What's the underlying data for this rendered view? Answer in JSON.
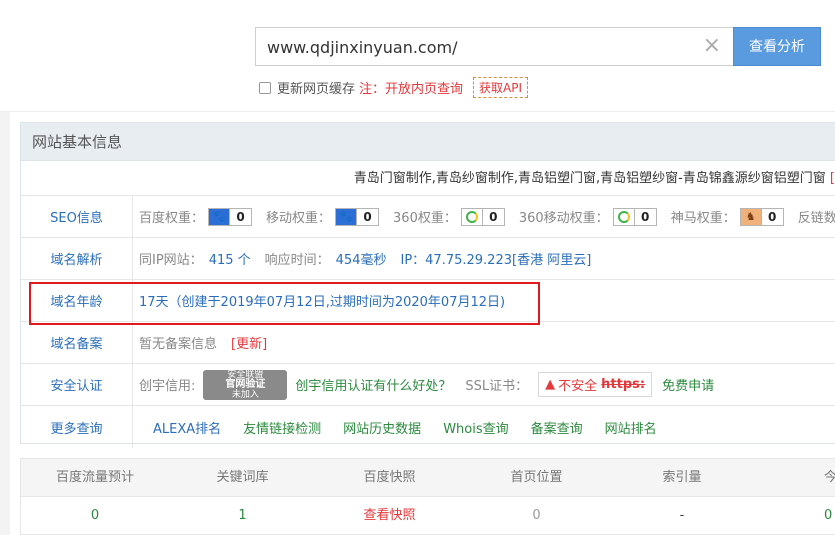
{
  "search": {
    "url": "www.qdjinxinyuan.com/",
    "clear_icon": "close-icon",
    "analyze_button": "查看分析",
    "refresh_cache_label": "更新网页缓存",
    "note": "注：开放内页查询",
    "api_button": "获取API"
  },
  "panel": {
    "title": "网站基本信息",
    "site_title": "青岛门窗制作,青岛纱窗制作,青岛铝塑门窗,青岛铝塑纱窗-青岛锦鑫源纱窗铝塑门窗",
    "site_title_bracket": "[",
    "seo": {
      "label": "SEO信息",
      "items": [
        {
          "name": "百度权重：",
          "icon": "baidu-paw-icon",
          "value": "0"
        },
        {
          "name": "移动权重：",
          "icon": "baidu-paw-icon",
          "value": "0"
        },
        {
          "name": "360权重：",
          "icon": "360-ring-icon",
          "value": "0"
        },
        {
          "name": "360移动权重：",
          "icon": "360-ring-icon",
          "value": "0"
        },
        {
          "name": "神马权重：",
          "icon": "shenma-horse-icon",
          "value": "0"
        }
      ],
      "backlinks_label": "反链数"
    },
    "dns": {
      "label": "域名解析",
      "same_ip_label": "同IP网站：",
      "same_ip_value": "415 个",
      "response_label": "响应时间：",
      "response_value": "454毫秒",
      "ip_value": "IP：47.75.29.223[香港 阿里云]"
    },
    "age": {
      "label": "域名年龄",
      "value": "17天（创建于2019年07月12日,过期时间为2020年07月12日)"
    },
    "icp": {
      "label": "域名备案",
      "value": "暂无备案信息",
      "update_link": "[更新]"
    },
    "security": {
      "label": "安全认证",
      "credit_label": "创宇信用:",
      "seal_line1": "安全联盟",
      "seal_line2": "官网验证",
      "seal_line3": "未加入",
      "credit_link": "创宇信用认证有什么好处？",
      "ssl_label": "SSL证书：",
      "ssl_warning": "不安全",
      "ssl_https": "https:",
      "ssl_apply": "免费申请"
    },
    "more": {
      "label": "更多查询",
      "links": [
        "ALEXA排名",
        "友情链接检测",
        "网站历史数据",
        "Whois查询",
        "备案查询",
        "网站排名"
      ]
    }
  },
  "stats": {
    "headers": [
      "百度流量预计",
      "关键词库",
      "百度快照",
      "首页位置",
      "索引量",
      "今日收"
    ],
    "values": [
      "0",
      "1",
      "查看快照",
      "0",
      "-",
      "0"
    ]
  },
  "colors": {
    "accent_blue": "#5a9be0",
    "link_blue": "#2a6ebb",
    "link_green": "#2b8a3e",
    "alert_red": "#e4393c",
    "highlight_box": "#e0191e"
  }
}
